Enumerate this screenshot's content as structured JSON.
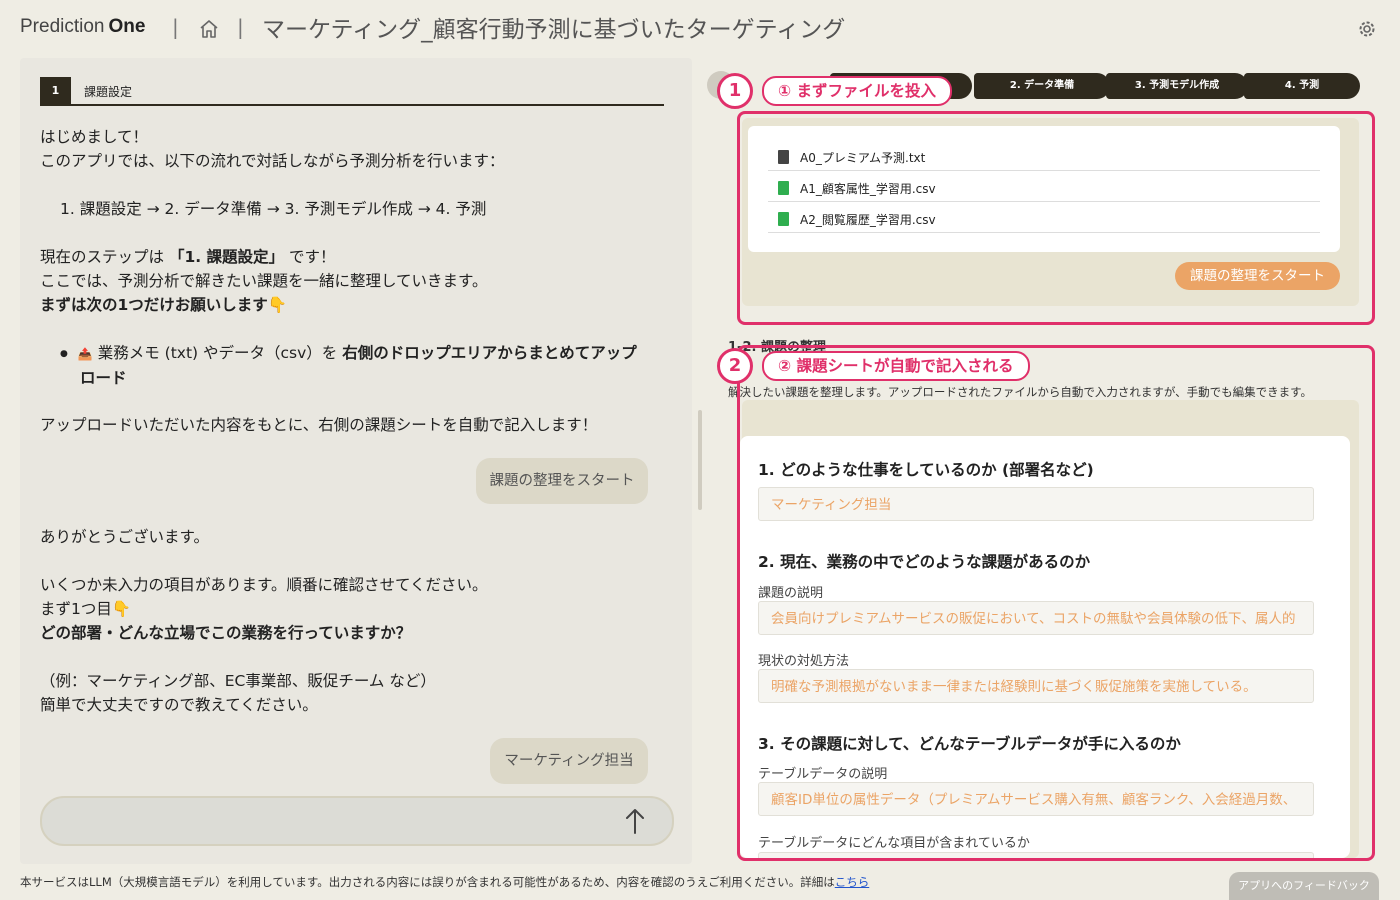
{
  "header": {
    "brand_part1": "Prediction",
    "brand_part2": "One",
    "separator": "|",
    "title": "マーケティング_顧客行動予測に基づいたターゲティング"
  },
  "chat": {
    "step_number": "1",
    "step_label": "課題設定",
    "messages": {
      "greeting": "はじめまして！",
      "intro": "このアプリでは、以下の流れで対話しながら予測分析を行います：",
      "flow": "1. 課題設定 → 2. データ準備 → 3. 予測モデル作成 → 4. 予測",
      "current_step_prefix": "現在のステップは ",
      "current_step_bold": "「1. 課題設定」",
      "current_step_suffix": " です！",
      "explain": "ここでは、予測分析で解きたい課題を一緒に整理していきます。",
      "request": "まずは次の1つだけお願いします👇",
      "bullet_icon": "📤",
      "bullet_text": " 業務メモ (txt) やデータ（csv）を ",
      "bullet_bold_1": "右側のドロップエリアからまとめてアップ",
      "bullet_bold_2": "ロード",
      "after_upload": "アップロードいただいた内容をもとに、右側の課題シートを自動で記入します！",
      "thanks": "ありがとうございます。",
      "missing": "いくつか未入力の項目があります。順番に確認させてください。",
      "first": "まず1つ目👇",
      "question": "どの部署・どんな立場でこの業務を行っていますか？",
      "example": "（例：マーケティング部、EC事業部、販促チーム など）",
      "easy": "簡単で大丈夫ですので教えてください。"
    },
    "user_bubble_1": "課題の整理をスタート",
    "user_bubble_2": "マーケティング担当"
  },
  "progress": {
    "steps": [
      {
        "label": "1. 課題設定"
      },
      {
        "label": "2. データ準備"
      },
      {
        "label": "3. 予測モデル作成"
      },
      {
        "label": "4. 予測"
      }
    ]
  },
  "callouts": {
    "one_num": "1",
    "one_label": "① まずファイルを投入",
    "two_num": "2",
    "two_label": "② 課題シートが自動で記入される"
  },
  "files": [
    {
      "name": "A0_プレミアム予測.txt",
      "type": "txt"
    },
    {
      "name": "A1_顧客属性_学習用.csv",
      "type": "csv"
    },
    {
      "name": "A2_閲覧履歴_学習用.csv",
      "type": "csv"
    }
  ],
  "upload": {
    "start_button": "課題の整理をスタート"
  },
  "sheet": {
    "section_title": "1-2. 課題の整理",
    "description": "解決したい課題を整理します。アップロードされたファイルから自動で入力されますが、手動でも編集できます。",
    "q1": "1. どのような仕事をしているのか (部署名など)",
    "q1_value": "マーケティング担当",
    "q2": "2. 現在、業務の中でどのような課題があるのか",
    "q2_label_a": "課題の説明",
    "q2_value_a": "会員向けプレミアムサービスの販促において、コストの無駄や会員体験の低下、属人的",
    "q2_label_b": "現状の対処方法",
    "q2_value_b": "明確な予測根拠がないまま一律または経験則に基づく販促施策を実施している。",
    "q3": "3. その課題に対して、どんなテーブルデータが手に入るのか",
    "q3_label_a": "テーブルデータの説明",
    "q3_value_a": "顧客ID単位の属性データ（プレミアムサービス購入有無、顧客ランク、入会経過月数、",
    "q3_label_b": "テーブルデータにどんな項目が含まれているか"
  },
  "footer": {
    "notice": "本サービスはLLM（大規模言語モデル）を利用しています。出力される内容には誤りが含まれる可能性があるため、内容を確認のうえご利用ください。詳細は",
    "link": "こちら",
    "feedback": "アプリへのフィードバック"
  },
  "colors": {
    "accent": "#e0306a",
    "orange": "#eba466",
    "dark": "#2f2a1e"
  },
  "icons": {
    "home": "home-icon",
    "settings": "gear-icon",
    "send": "arrow-up-icon",
    "txt_file": "txt-file-icon",
    "csv_file": "csv-file-icon"
  }
}
